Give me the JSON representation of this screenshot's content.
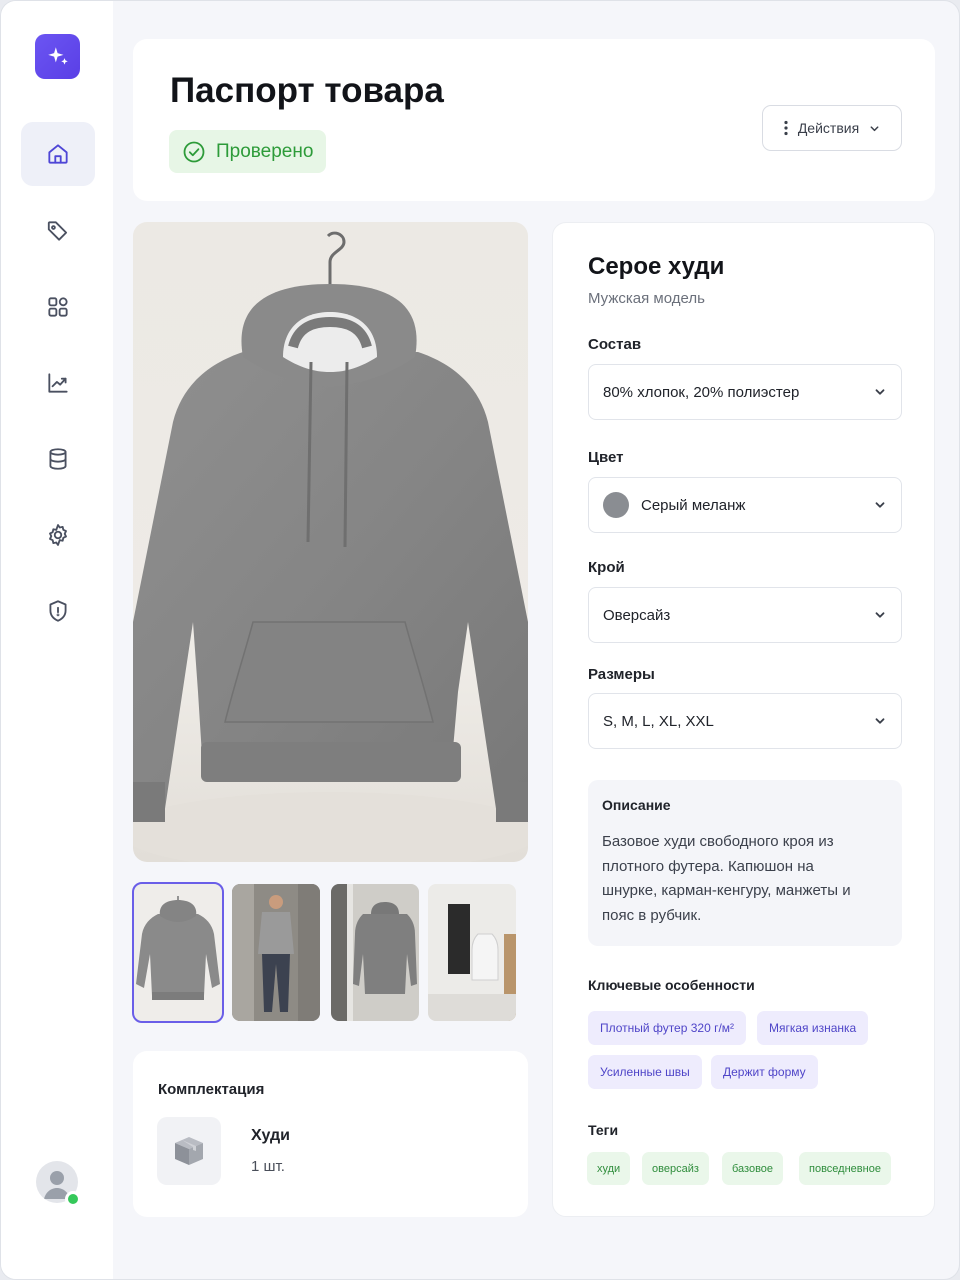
{
  "header": {
    "title": "Паспорт товара",
    "status": "Проверено",
    "actions_label": "Действия"
  },
  "sidebar": {
    "items": [
      {
        "icon": "home-icon",
        "active": true
      },
      {
        "icon": "tag-icon"
      },
      {
        "icon": "grid-icon"
      },
      {
        "icon": "chart-icon"
      },
      {
        "icon": "database-icon"
      },
      {
        "icon": "gear-icon"
      },
      {
        "icon": "shield-icon"
      }
    ]
  },
  "product": {
    "name": "Серое худи",
    "subtitle": "Мужская модель",
    "fields": {
      "composition": {
        "label": "Состав",
        "value": "80% хлопок, 20% полиэстер"
      },
      "color": {
        "label": "Цвет",
        "value": "Серый меланж",
        "swatch": "#8a8d92"
      },
      "cut": {
        "label": "Крой",
        "value": "Оверсайз"
      },
      "sizes": {
        "label": "Размеры",
        "value": "S, M, L, XL, XXL"
      }
    },
    "description": {
      "title": "Описание",
      "text": "Базовое худи свободного кроя из плотного футера. Капюшон на шнурке, карман-кенгуру, манжеты и пояс в рубчик."
    },
    "features": {
      "title": "Ключевые особенности",
      "items": [
        "Плотный футер 320 г/м²",
        "Мягкая изнанка",
        "Усиленные швы",
        "Держит форму"
      ]
    },
    "tags": {
      "title": "Теги",
      "items": [
        "худи",
        "оверсайз",
        "базовое",
        "повседневное"
      ]
    }
  },
  "kit": {
    "title": "Комплектация",
    "item_name": "Худи",
    "item_qty": "1 шт."
  },
  "colors": {
    "accent": "#5a3fe6",
    "success": "#2d9b39"
  }
}
